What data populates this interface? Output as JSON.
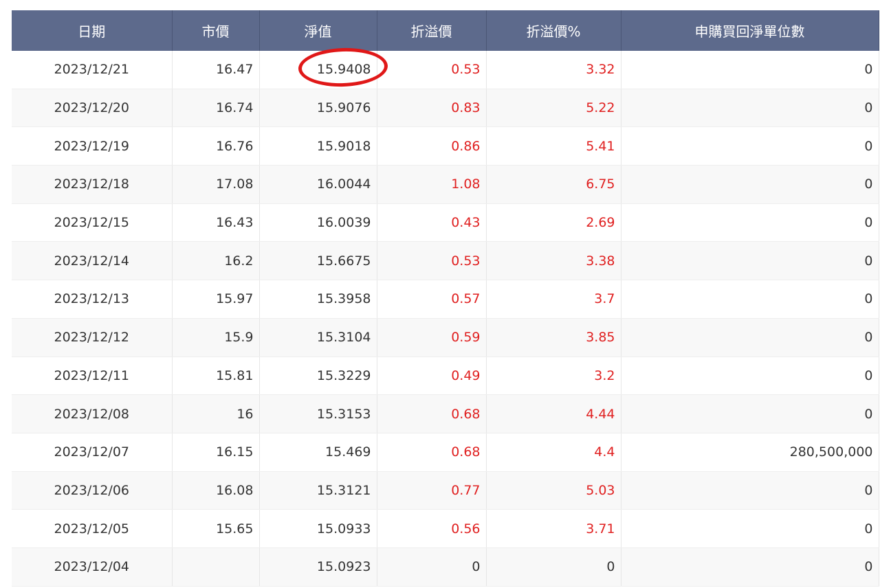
{
  "columns": [
    "日期",
    "市價",
    "淨值",
    "折溢價",
    "折溢價%",
    "申購買回淨單位數"
  ],
  "rows": [
    [
      "2023/12/21",
      "16.47",
      "15.9408",
      "0.53",
      "3.32",
      "0"
    ],
    [
      "2023/12/20",
      "16.74",
      "15.9076",
      "0.83",
      "5.22",
      "0"
    ],
    [
      "2023/12/19",
      "16.76",
      "15.9018",
      "0.86",
      "5.41",
      "0"
    ],
    [
      "2023/12/18",
      "17.08",
      "16.0044",
      "1.08",
      "6.75",
      "0"
    ],
    [
      "2023/12/15",
      "16.43",
      "16.0039",
      "0.43",
      "2.69",
      "0"
    ],
    [
      "2023/12/14",
      "16.2",
      "15.6675",
      "0.53",
      "3.38",
      "0"
    ],
    [
      "2023/12/13",
      "15.97",
      "15.3958",
      "0.57",
      "3.7",
      "0"
    ],
    [
      "2023/12/12",
      "15.9",
      "15.3104",
      "0.59",
      "3.85",
      "0"
    ],
    [
      "2023/12/11",
      "15.81",
      "15.3229",
      "0.49",
      "3.2",
      "0"
    ],
    [
      "2023/12/08",
      "16",
      "15.3153",
      "0.68",
      "4.44",
      "0"
    ],
    [
      "2023/12/07",
      "16.15",
      "15.469",
      "0.68",
      "4.4",
      "280,500,000"
    ],
    [
      "2023/12/06",
      "16.08",
      "15.3121",
      "0.77",
      "5.03",
      "0"
    ],
    [
      "2023/12/05",
      "15.65",
      "15.0933",
      "0.56",
      "3.71",
      "0"
    ],
    [
      "2023/12/04",
      "",
      "15.0923",
      "0",
      "0",
      "0"
    ]
  ],
  "colors": {
    "header": "#5d6a8c",
    "positive": "#e02020",
    "annotation": "#e01818"
  }
}
